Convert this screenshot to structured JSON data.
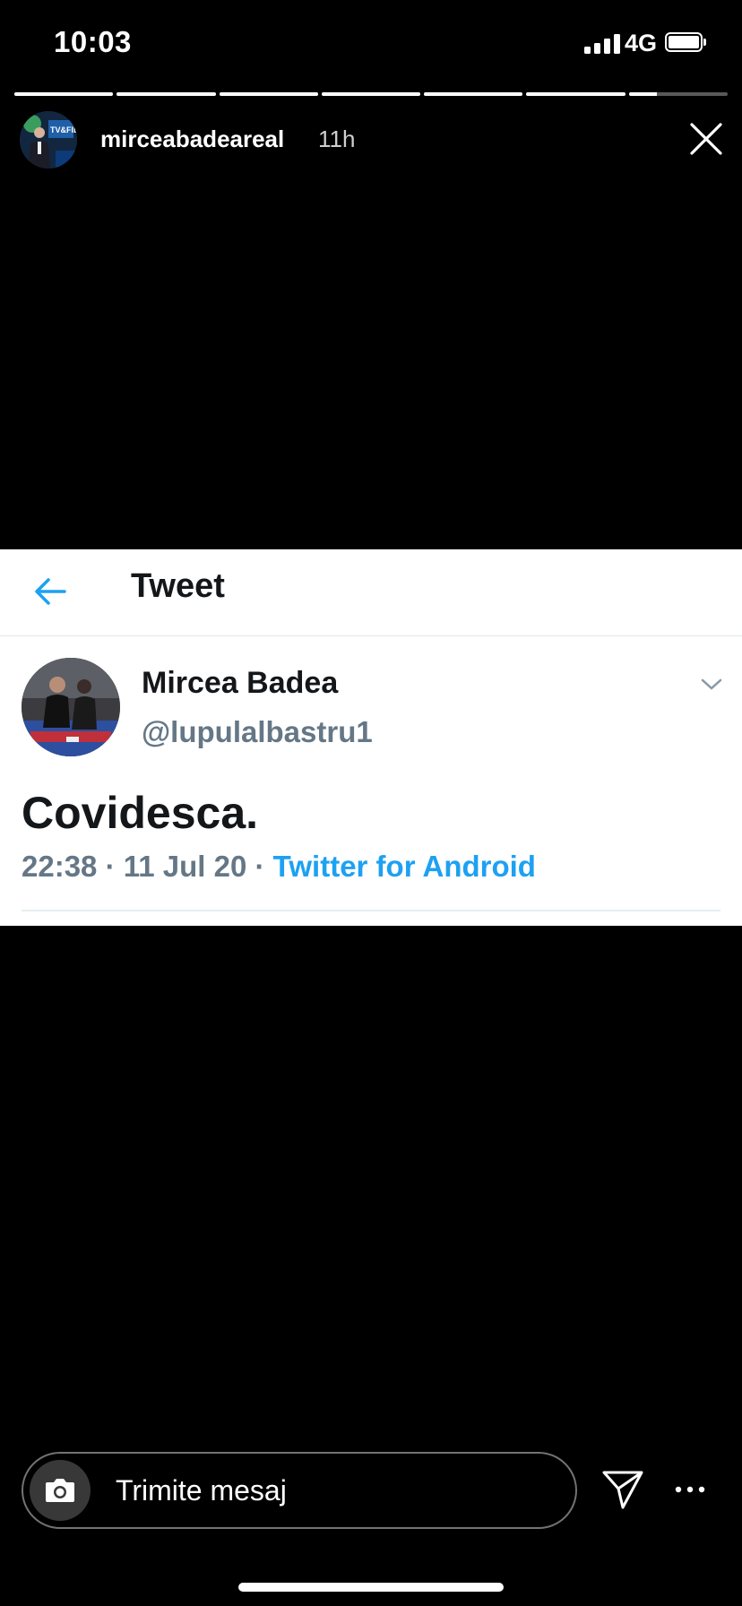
{
  "status_bar": {
    "time": "10:03",
    "network": "4G",
    "signal_bars": 4,
    "battery_level": 1.0
  },
  "story": {
    "progress": [
      1,
      1,
      1,
      1,
      1,
      1,
      0.28
    ],
    "username": "mirceabadeareal",
    "age": "11h",
    "avatar_icon": "profile-avatar",
    "close_icon": "close-x-icon"
  },
  "tweet": {
    "header": "Tweet",
    "back_icon": "back-arrow-icon",
    "author_name": "Mircea Badea",
    "author_handle": "@lupulalbastru1",
    "text": "Covidesca.",
    "meta_prefix": "22:38 · 11 Jul 20 · ",
    "source": "Twitter for Android",
    "menu_icon": "chevron-down-icon",
    "colors": {
      "link": "#1da1f2",
      "secondary": "#657786"
    }
  },
  "reply_bar": {
    "placeholder": "Trimite mesaj",
    "camera_icon": "camera-icon",
    "send_icon": "send-direct-icon",
    "more_icon": "more-horizontal-icon"
  }
}
